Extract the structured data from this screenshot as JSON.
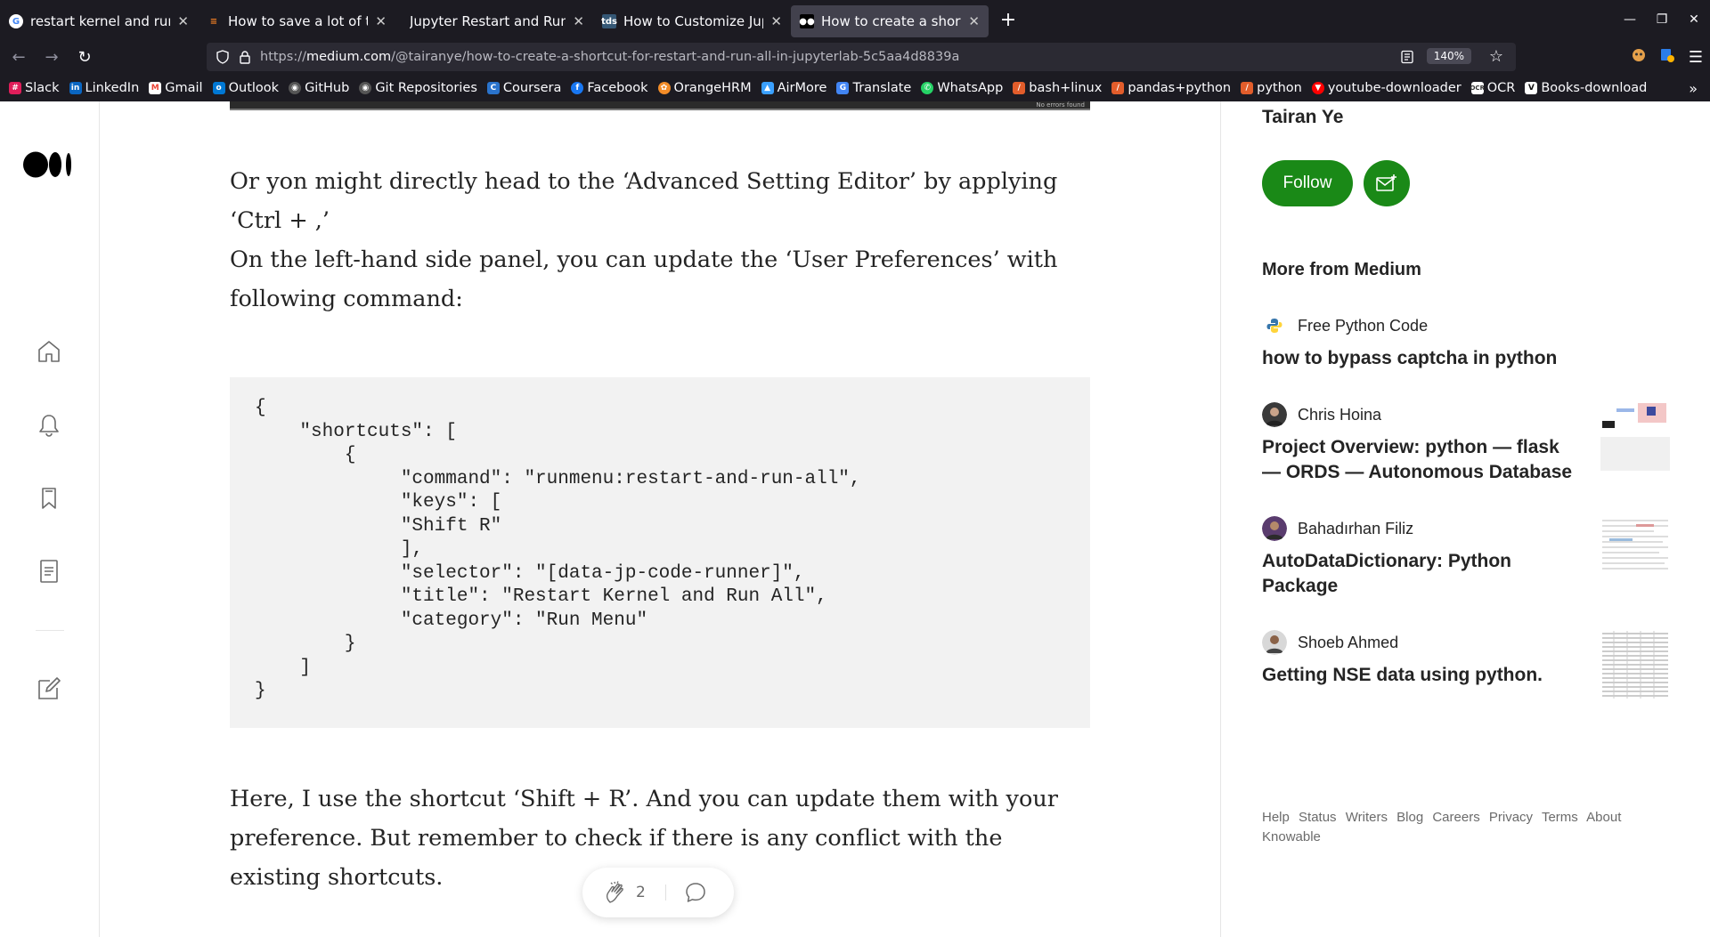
{
  "browser": {
    "tabs": [
      {
        "label": "restart kernel and run all",
        "icon": "google-icon",
        "active": false
      },
      {
        "label": "How to save a lot of time",
        "icon": "stackoverflow-icon",
        "active": false
      },
      {
        "label": "Jupyter Restart and Run All",
        "icon": "none",
        "active": false
      },
      {
        "label": "How to Customize Jupyter",
        "icon": "tds-icon",
        "active": false
      },
      {
        "label": "How to create a shortcut",
        "icon": "medium-icon",
        "active": true
      }
    ],
    "url_prefix": "https://",
    "url_domain": "medium.com",
    "url_path": "/@tairanye/how-to-create-a-shortcut-for-restart-and-run-all-in-jupyterlab-5c5aa4d8839a",
    "zoom": "140%",
    "bookmarks": [
      {
        "label": "Slack",
        "icon": "slack-icon",
        "color": "#e01e5a"
      },
      {
        "label": "LinkedIn",
        "icon": "linkedin-icon",
        "color": "#0a66c2"
      },
      {
        "label": "Gmail",
        "icon": "gmail-icon",
        "color": "#ea4335"
      },
      {
        "label": "Outlook",
        "icon": "outlook-icon",
        "color": "#0078d4"
      },
      {
        "label": "GitHub",
        "icon": "github-icon",
        "color": "#555555"
      },
      {
        "label": "Git Repositories",
        "icon": "github-icon",
        "color": "#555555"
      },
      {
        "label": "Coursera",
        "icon": "coursera-icon",
        "color": "#2a73cc"
      },
      {
        "label": "Facebook",
        "icon": "facebook-icon",
        "color": "#1877f2"
      },
      {
        "label": "OrangeHRM",
        "icon": "orangehrm-icon",
        "color": "#f28c28"
      },
      {
        "label": "AirMore",
        "icon": "airmore-icon",
        "color": "#3aa0ff"
      },
      {
        "label": "Translate",
        "icon": "translate-icon",
        "color": "#4285f4"
      },
      {
        "label": "WhatsApp",
        "icon": "whatsapp-icon",
        "color": "#25d366"
      },
      {
        "label": "bash+linux",
        "icon": "bookmark-icon",
        "color": "#e25d2b"
      },
      {
        "label": "pandas+python",
        "icon": "bookmark-icon",
        "color": "#e25d2b"
      },
      {
        "label": "python",
        "icon": "bookmark-icon",
        "color": "#e25d2b"
      },
      {
        "label": "youtube-downloader",
        "icon": "youtube-icon",
        "color": "#ff0000"
      },
      {
        "label": "OCR",
        "icon": "ocr-icon",
        "color": "#777777"
      },
      {
        "label": "Books-download",
        "icon": "books-icon",
        "color": "#ffffff"
      }
    ]
  },
  "article": {
    "image_caption": "No errors found",
    "para1": "Or yon might directly head to the ‘Advanced Setting Editor’ by applying ‘Ctrl + ,’",
    "para2": "On the left-hand side panel, you can update the ‘User Preferences’ with following command:",
    "code": "{\n    \"shortcuts\": [\n        {\n             \"command\": \"runmenu:restart-and-run-all\",\n             \"keys\": [\n             \"Shift R\"\n             ],\n             \"selector\": \"[data-jp-code-runner]\",\n             \"title\": \"Restart Kernel and Run All\",\n             \"category\": \"Run Menu\"\n        }\n    ]\n}",
    "para3": "Here, I use the shortcut ‘Shift + R’. And you can update them with your preference. But remember to check if there is any conflict with the existing shortcuts.",
    "clap_count": "2"
  },
  "sidebar": {
    "author": "Tairan Ye",
    "follow_label": "Follow",
    "more_heading": "More from Medium",
    "stories": [
      {
        "writer": "Free Python Code",
        "title": "how to bypass captcha in python",
        "has_thumb": false
      },
      {
        "writer": "Chris Hoina",
        "title": "Project Overview: python — flask — ORDS — Autonomous Database",
        "has_thumb": true
      },
      {
        "writer": "Bahadırhan Filiz",
        "title": "AutoDataDictionary: Python Package",
        "has_thumb": true
      },
      {
        "writer": "Shoeb Ahmed",
        "title": "Getting NSE data using python.",
        "has_thumb": true
      }
    ],
    "footer_links": [
      "Help",
      "Status",
      "Writers",
      "Blog",
      "Careers",
      "Privacy",
      "Terms",
      "About",
      "Knowable"
    ]
  }
}
